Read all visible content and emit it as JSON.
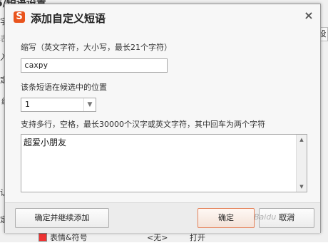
{
  "background": {
    "title_fragment": "5/短语设置",
    "fragments": [
      "字",
      "表",
      "入",
      "定",
      "编",
      "设",
      "认",
      "定"
    ],
    "bottom_checkbox_label": "表情&符号",
    "bottom_value": "<无>",
    "bottom_action": "打开"
  },
  "dialog": {
    "logo_letter": "S",
    "title": "添加自定义短语",
    "close_glyph": "×",
    "abbr_label": "缩写（英文字符，大小写，最长21个字符）",
    "abbr_value": "caxpy",
    "position_label": "该条短语在候选中的位置",
    "position_value": "1",
    "content_label": "支持多行，空格，最长30000个汉字或英文字符，其中回车为两个字符",
    "content_value": "超爱小朋友",
    "buttons": {
      "continue": "确定并继续添加",
      "ok": "确定",
      "cancel": "取消"
    }
  },
  "watermark": "Baidu 经验",
  "colors": {
    "logo": "#e9541d",
    "ok_border": "#e4825a"
  },
  "icons": {
    "close": "close-icon",
    "dropdown": "chevron-down-icon",
    "scroll_up": "triangle-up-icon",
    "scroll_down": "triangle-down-icon"
  }
}
